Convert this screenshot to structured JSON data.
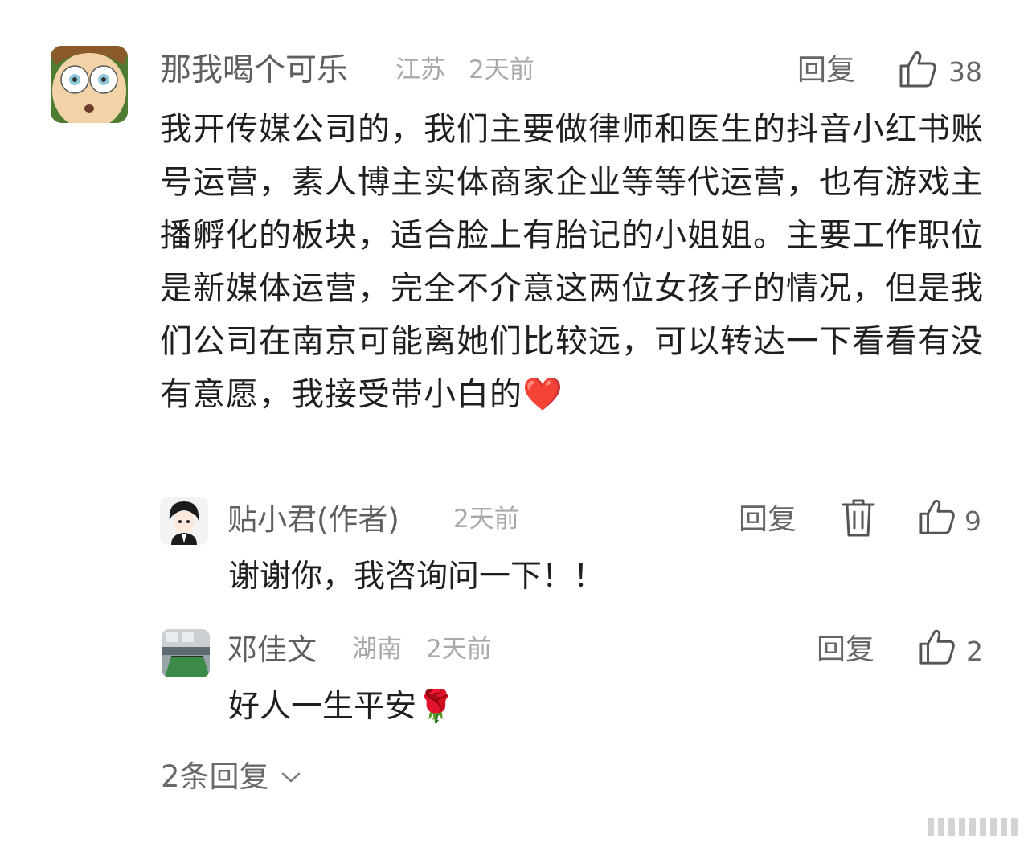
{
  "comment": {
    "author": "那我喝个可乐",
    "location": "江苏",
    "time": "2天前",
    "reply_label": "回复",
    "likes": "38",
    "text": "我开传媒公司的，我们主要做律师和医生的抖音小红书账号运营，素人博主实体商家企业等等代运营，也有游戏主播孵化的板块，适合脸上有胎记的小姐姐。主要工作职位是新媒体运营，完全不介意这两位女孩子的情况，但是我们公司在南京可能离她们比较远，可以转达一下看看有没有意愿，我接受带小白的",
    "emoji": "❤️"
  },
  "replies": [
    {
      "author": "贴小君(作者)",
      "time": "2天前",
      "reply_label": "回复",
      "likes": "9",
      "text": "谢谢你，我咨询问一下！！"
    },
    {
      "author": "邓佳文",
      "location": "湖南",
      "time": "2天前",
      "reply_label": "回复",
      "likes": "2",
      "text": "好人一生平安",
      "emoji": "🌹"
    }
  ],
  "more_replies_label": "2条回复",
  "colors": {
    "name": "#5f5f5f",
    "meta": "#a9a9a9",
    "body": "#1f1f1f",
    "action": "#666666"
  }
}
